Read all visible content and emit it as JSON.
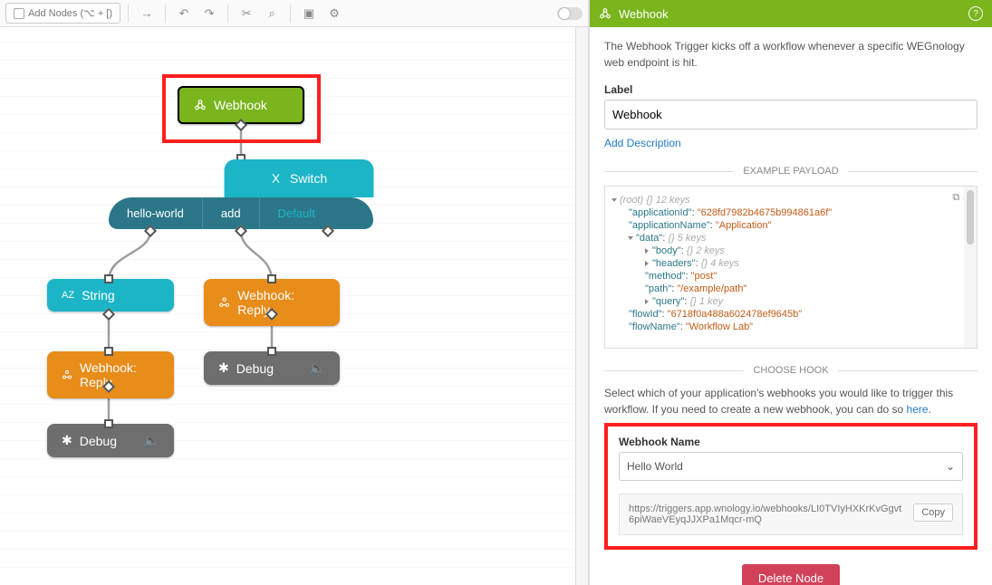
{
  "toolbar": {
    "add_nodes_label": "Add Nodes (⌥ + [)"
  },
  "nodes": {
    "webhook": "Webhook",
    "switch": "Switch",
    "cases": [
      "hello-world",
      "add",
      "Default"
    ],
    "string": "String",
    "reply1": "Webhook: Reply",
    "reply2": "Webhook: Reply",
    "debug1": "Debug",
    "debug2": "Debug"
  },
  "panel": {
    "title": "Webhook",
    "description": "The Webhook Trigger kicks off a workflow whenever a specific WEGnology web endpoint is hit.",
    "label_heading": "Label",
    "label_value": "Webhook",
    "add_description": "Add Description",
    "section_payload": "EXAMPLE PAYLOAD",
    "section_hook": "CHOOSE HOOK",
    "hook_intro_a": "Select which of your application's webhooks you would like to trigger this workflow. If you need to create a new webhook, you can do so ",
    "hook_intro_link": "here",
    "webhook_name_label": "Webhook Name",
    "webhook_selected": "Hello World",
    "webhook_url": "https://triggers.app.wnology.io/webhooks/LI0TVIyHXKrKvGgvt6piWaeVEyqJJXPa1Mqcr-mQ",
    "copy_label": "Copy",
    "delete_label": "Delete Node"
  },
  "payload": {
    "root_meta": "(root) {} 12 keys",
    "applicationId_k": "\"applicationId\"",
    "applicationId_v": "\"628fd7982b4675b994861a6f\"",
    "applicationName_k": "\"applicationName\"",
    "applicationName_v": "\"Application\"",
    "data_k": "\"data\"",
    "data_meta": "{} 5 keys",
    "body_k": "\"body\"",
    "body_meta": "{} 2 keys",
    "headers_k": "\"headers\"",
    "headers_meta": "{} 4 keys",
    "method_k": "\"method\"",
    "method_v": "\"post\"",
    "path_k": "\"path\"",
    "path_v": "\"/example/path\"",
    "query_k": "\"query\"",
    "query_meta": "{} 1 key",
    "flowId_k": "\"flowId\"",
    "flowId_v": "\"6718f0a488a602478ef9645b\"",
    "flowName_k": "\"flowName\"",
    "flowName_v": "\"Workflow Lab\""
  }
}
